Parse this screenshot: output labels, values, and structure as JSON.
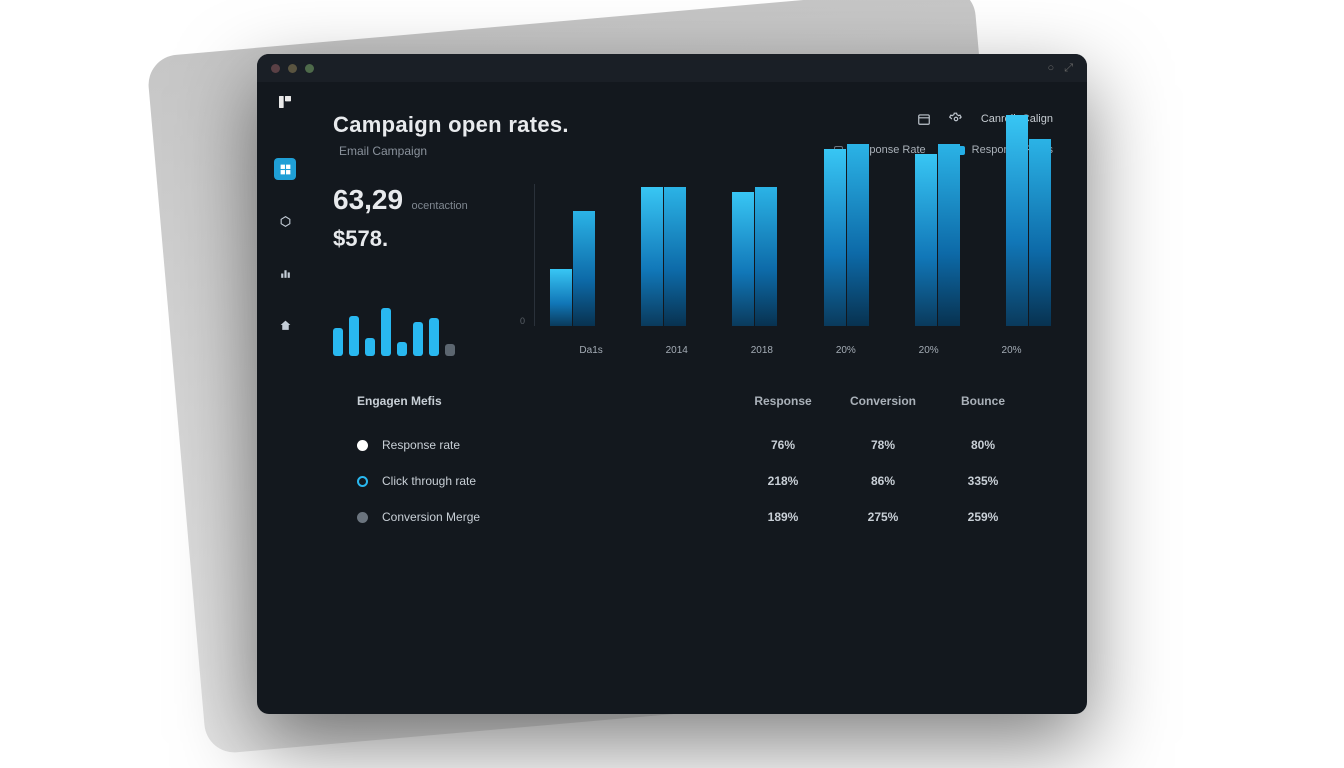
{
  "header": {
    "title": "Campaign open rates.",
    "subtitle": "Email Campaign",
    "action_label": "Canrell. Calign"
  },
  "legend": {
    "item1": "Response Rate",
    "item2": "Response Rates"
  },
  "kpi": {
    "big_value": "63,29",
    "big_label": "ocentaction",
    "money": "$578.",
    "sparkline": [
      28,
      40,
      18,
      48,
      14,
      34,
      38,
      12
    ]
  },
  "chart_data": {
    "type": "bar",
    "title": "Campaign open rates.",
    "xlabel": "",
    "ylabel": "",
    "ylim": [
      0,
      240
    ],
    "categories": [
      "Da1s",
      "2014",
      "2018",
      "20%",
      "20%",
      "20%"
    ],
    "series": [
      {
        "name": "Response Rate",
        "values": [
          60,
          145,
          140,
          185,
          180,
          220
        ]
      },
      {
        "name": "Response Rates",
        "values": [
          120,
          145,
          145,
          190,
          190,
          195
        ]
      }
    ],
    "y_zero_label": "0"
  },
  "table": {
    "title": "Engagen Mefis",
    "columns": [
      "Response",
      "Conversion",
      "Bounce"
    ],
    "rows": [
      {
        "name": "Response rate",
        "cells": [
          "76%",
          "78%",
          "80%"
        ]
      },
      {
        "name": "Click through rate",
        "cells": [
          "218%",
          "86%",
          "335%"
        ]
      },
      {
        "name": "Conversion Merge",
        "cells": [
          "189%",
          "275%",
          "259%"
        ]
      }
    ]
  }
}
